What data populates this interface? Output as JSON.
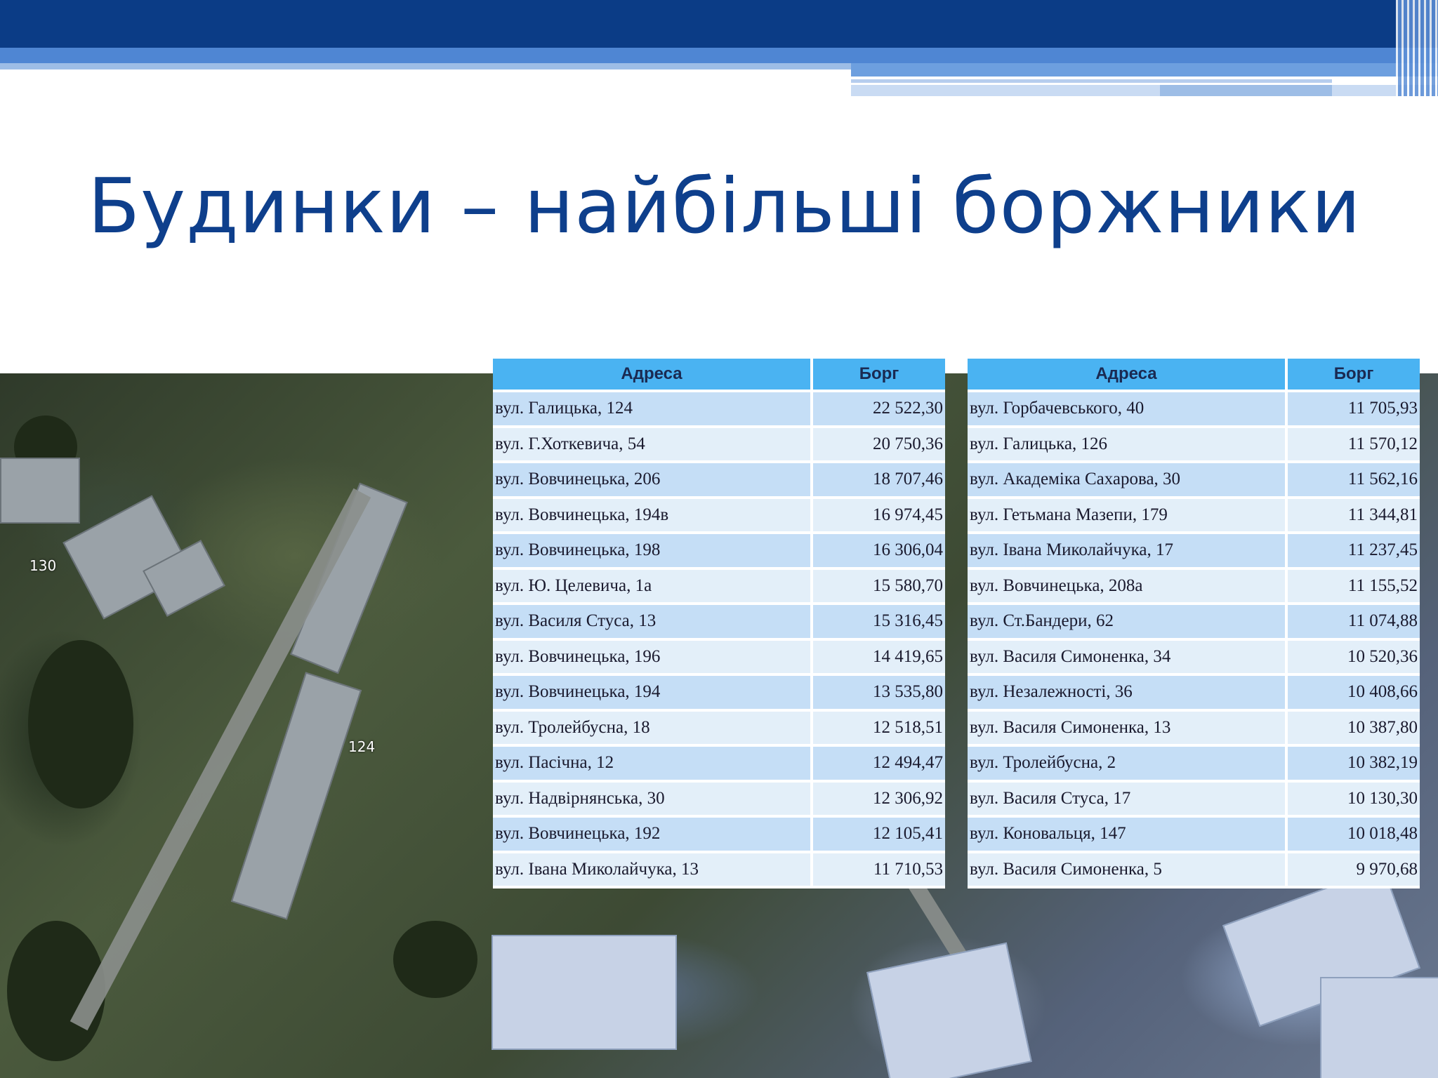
{
  "slide": {
    "title": "Будинки – найбільші боржники",
    "colors": {
      "banner_dark": "#0b3c86",
      "banner_mid": "#4f86d3",
      "title": "#0e3f8c",
      "table_header": "#4ab3f2",
      "row_odd": "#c5def6",
      "row_even": "#e3eff9"
    }
  },
  "map": {
    "labels": [
      "130",
      "124"
    ]
  },
  "table_left": {
    "headers": [
      "Адреса",
      "Борг"
    ],
    "rows": [
      {
        "address": "вул. Галицька,  124",
        "debt": "22 522,30"
      },
      {
        "address": "вул. Г.Хоткевича,   54",
        "debt": "20 750,36"
      },
      {
        "address": "вул. Вовчинецька,  206",
        "debt": "18 707,46"
      },
      {
        "address": "вул. Вовчинецька, 194в",
        "debt": "16 974,45"
      },
      {
        "address": "вул. Вовчинецька,  198",
        "debt": "16 306,04"
      },
      {
        "address": "вул. Ю. Целевича,   1а",
        "debt": "15 580,70"
      },
      {
        "address": "вул. Василя Стуса,   13",
        "debt": "15 316,45"
      },
      {
        "address": "вул. Вовчинецька,  196",
        "debt": "14 419,65"
      },
      {
        "address": "вул. Вовчинецька,  194",
        "debt": "13 535,80"
      },
      {
        "address": "вул. Тролейбусна,   18",
        "debt": "12 518,51"
      },
      {
        "address": "вул. Пасічна,   12",
        "debt": "12 494,47"
      },
      {
        "address": "вул. Надвірнянська,   30",
        "debt": "12 306,92"
      },
      {
        "address": "вул. Вовчинецька,  192",
        "debt": "12 105,41"
      },
      {
        "address": "вул. Івана Миколайчука,   13",
        "debt": "11 710,53"
      }
    ]
  },
  "table_right": {
    "headers": [
      "Адреса",
      "Борг"
    ],
    "rows": [
      {
        "address": "вул. Горбачевського,   40",
        "debt": "11 705,93"
      },
      {
        "address": "вул. Галицька,  126",
        "debt": "11 570,12"
      },
      {
        "address": "вул. Академіка Сахарова,   30",
        "debt": "11 562,16"
      },
      {
        "address": "вул. Гетьмана Мазепи,  179",
        "debt": "11 344,81"
      },
      {
        "address": "вул. Івана Миколайчука,   17",
        "debt": "11 237,45"
      },
      {
        "address": "вул. Вовчинецька, 208а",
        "debt": "11 155,52"
      },
      {
        "address": "вул. Ст.Бандери,   62",
        "debt": "11 074,88"
      },
      {
        "address": "вул. Василя Симоненка,   34",
        "debt": "10 520,36"
      },
      {
        "address": "вул. Незалежності,   36",
        "debt": "10 408,66"
      },
      {
        "address": "вул. Василя Симоненка,   13",
        "debt": "10 387,80"
      },
      {
        "address": "вул. Тролейбусна,   2",
        "debt": "10 382,19"
      },
      {
        "address": "вул. Василя Стуса,   17",
        "debt": "10 130,30"
      },
      {
        "address": "вул. Коновальця,  147",
        "debt": "10 018,48"
      },
      {
        "address": "вул. Василя Симоненка,   5",
        "debt": "9 970,68"
      }
    ]
  }
}
